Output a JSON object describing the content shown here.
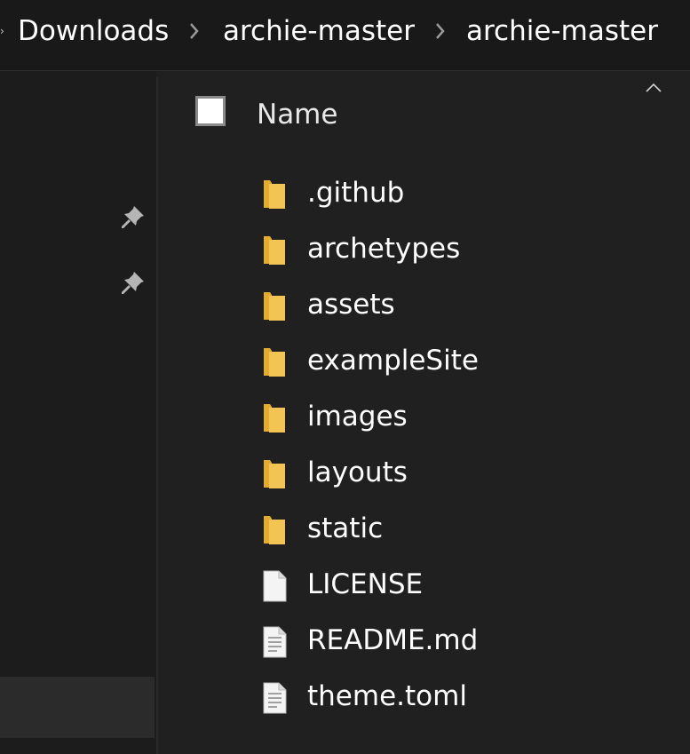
{
  "breadcrumb": {
    "items": [
      "Downloads",
      "archie-master",
      "archie-master"
    ]
  },
  "nav": {
    "pins": [
      "pin-icon",
      "pin-icon"
    ]
  },
  "header": {
    "name_label": "Name"
  },
  "files": [
    {
      "name": ".github",
      "type": "folder"
    },
    {
      "name": "archetypes",
      "type": "folder"
    },
    {
      "name": "assets",
      "type": "folder"
    },
    {
      "name": "exampleSite",
      "type": "folder"
    },
    {
      "name": "images",
      "type": "folder"
    },
    {
      "name": "layouts",
      "type": "folder"
    },
    {
      "name": "static",
      "type": "folder"
    },
    {
      "name": "LICENSE",
      "type": "file"
    },
    {
      "name": "README.md",
      "type": "text"
    },
    {
      "name": "theme.toml",
      "type": "text"
    }
  ],
  "colors": {
    "folder": "#f3c453",
    "folder_dark": "#e3ac2e",
    "background": "#202020"
  }
}
